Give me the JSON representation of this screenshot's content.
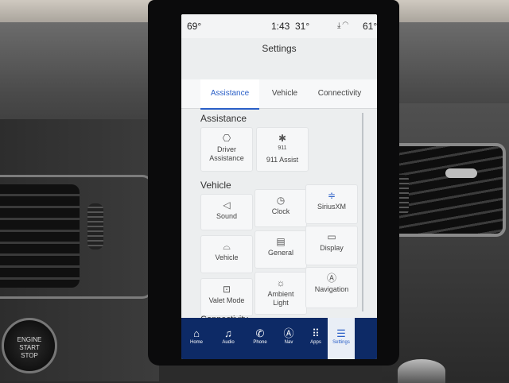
{
  "status_bar": {
    "outside_temp": "69°",
    "time": "1:43",
    "inside_temp": "31°",
    "right_temp": "61°",
    "icons": [
      "no-phone-icon",
      "wifi-icon"
    ]
  },
  "page_title": "Settings",
  "tabs": [
    {
      "label": "Assistance",
      "active": true
    },
    {
      "label": "Vehicle",
      "active": false
    },
    {
      "label": "Connectivity",
      "active": false
    }
  ],
  "sections": {
    "assistance": {
      "heading": "Assistance",
      "tiles": [
        {
          "label_1": "Driver",
          "label_2": "Assistance",
          "icon": "driver-assist-icon"
        },
        {
          "badge": "911",
          "label_1": "911 Assist",
          "icon": "asterisk-icon"
        }
      ]
    },
    "vehicle": {
      "heading": "Vehicle",
      "tiles": [
        {
          "label_1": "Sound",
          "icon": "speaker-icon"
        },
        {
          "label_1": "Clock",
          "icon": "clock-icon"
        },
        {
          "label_1": "SiriusXM",
          "icon": "siriusxm-icon"
        },
        {
          "label_1": "Vehicle",
          "icon": "car-icon"
        },
        {
          "label_1": "General",
          "icon": "keyboard-icon"
        },
        {
          "label_1": "Display",
          "icon": "display-icon"
        },
        {
          "label_1": "Valet Mode",
          "icon": "valet-lock-icon"
        },
        {
          "label_1": "Ambient",
          "label_2": "Light",
          "icon": "ambient-light-icon"
        },
        {
          "label_1": "Navigation",
          "icon": "navigation-icon"
        }
      ]
    },
    "connectivity_heading": "Connectivity"
  },
  "bottom_nav": [
    {
      "label": "Home",
      "icon": "home-icon",
      "active": false
    },
    {
      "label": "Audio",
      "icon": "music-note-icon",
      "active": false
    },
    {
      "label": "Phone",
      "icon": "phone-icon",
      "active": false
    },
    {
      "label": "Nav",
      "icon": "nav-arrow-icon",
      "active": false
    },
    {
      "label": "Apps",
      "icon": "apps-grid-icon",
      "active": false
    },
    {
      "label": "Settings",
      "icon": "settings-sliders-icon",
      "active": true
    }
  ],
  "console": {
    "engine_button_line_1": "ENGINE",
    "engine_button_line_2": "START",
    "engine_button_line_3": "STOP"
  },
  "colors": {
    "accent": "#2a5fc7",
    "nav_bar": "#0d2a66",
    "screen_bg": "#eceeef"
  }
}
